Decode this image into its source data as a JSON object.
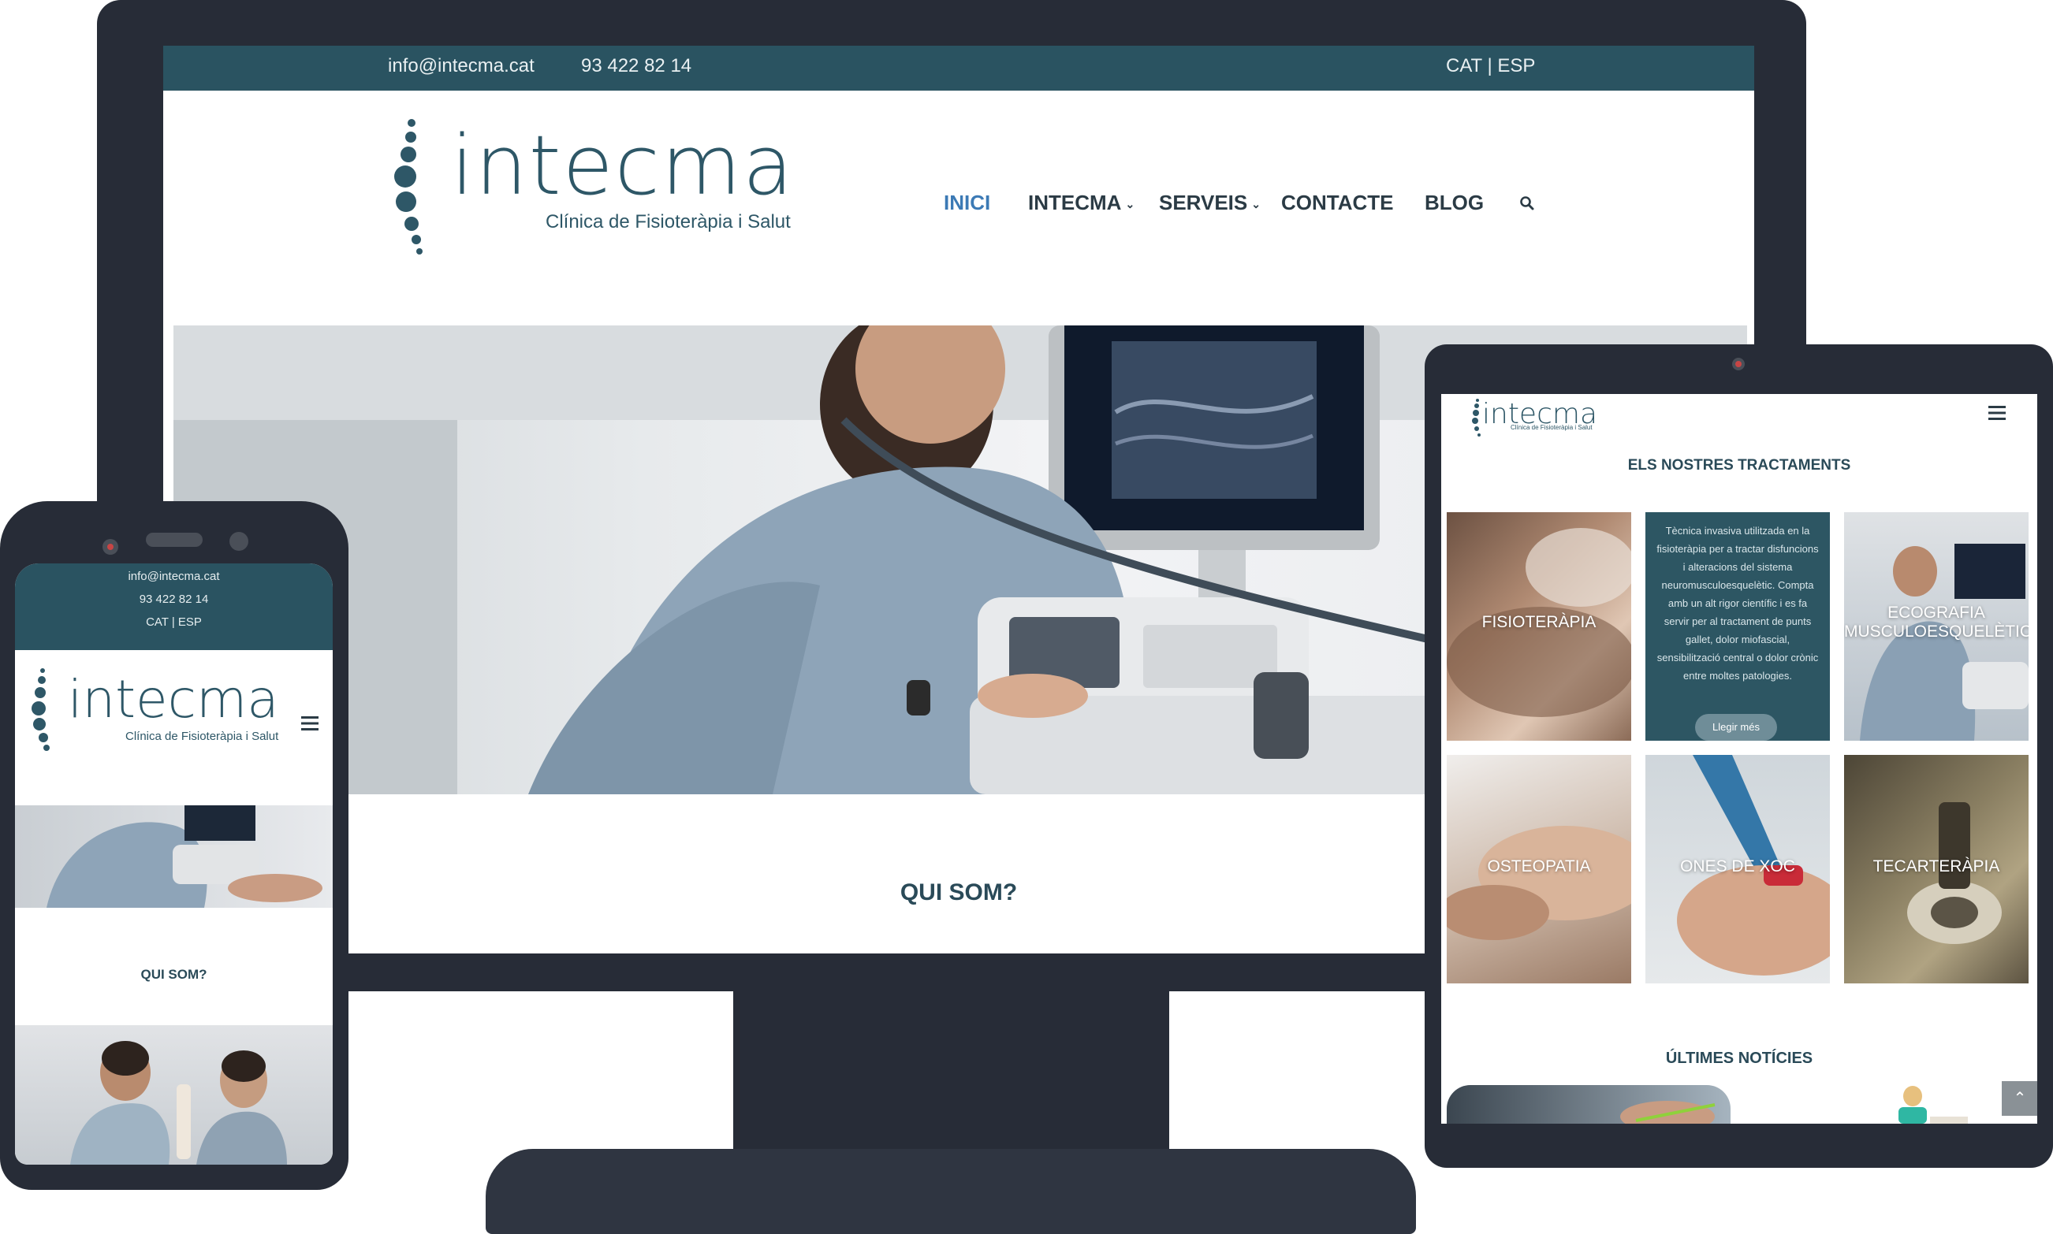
{
  "desktop": {
    "topbar": {
      "email": "info@intecma.cat",
      "phone": "93 422 82 14",
      "lang": "CAT | ESP"
    },
    "logo": {
      "name": "intecma",
      "tagline": "Clínica de Fisioteràpia i Salut"
    },
    "nav": [
      {
        "label": "INICI",
        "dropdown": false,
        "active": true
      },
      {
        "label": "INTECMA",
        "dropdown": true,
        "active": false
      },
      {
        "label": "SERVEIS",
        "dropdown": true,
        "active": false
      },
      {
        "label": "CONTACTE",
        "dropdown": false,
        "active": false
      },
      {
        "label": "BLOG",
        "dropdown": false,
        "active": false
      }
    ],
    "section_heading": "QUI SOM?"
  },
  "phone": {
    "topbar": {
      "email": "info@intecma.cat",
      "phone": "93 422 82 14",
      "lang": "CAT | ESP"
    },
    "logo": {
      "name": "intecma",
      "tagline": "Clínica de Fisioteràpia i Salut"
    },
    "section_heading": "QUI SOM?"
  },
  "tablet": {
    "logo": {
      "name": "intecma",
      "tagline": "Clínica de Fisioteràpia i Salut"
    },
    "treatments_heading": "ELS NOSTRES TRACTAMENTS",
    "treatments": [
      {
        "label": "FISIOTERÀPIA"
      },
      {
        "label": "",
        "description": "Tècnica invasiva utilitzada en la fisioteràpia per a tractar disfuncions i alteracions del sistema neuromusculoesquelètic. Compta amb un alt rigor científic i es fa servir per al tractament de punts gallet, dolor miofascial, sensibilització central o dolor crònic entre moltes patologies.",
        "button": "Llegir més"
      },
      {
        "label": "ECOGRAFIA MUSCULOESQUELÈTICA"
      },
      {
        "label": "OSTEOPATIA"
      },
      {
        "label": "ONES DE XOC"
      },
      {
        "label": "TECARTERÀPIA"
      }
    ],
    "news_heading": "ÚLTIMES NOTÍCIES"
  },
  "icons": {
    "search": "search-icon",
    "menu": "hamburger-menu-icon",
    "scroll_top": "chevron-up-icon"
  },
  "colors": {
    "topbar": "#2a5361",
    "bezel": "#272c37",
    "nav_active": "#3c7ab5",
    "heading": "#2a4a58",
    "tile_teal": "#2d5663"
  }
}
